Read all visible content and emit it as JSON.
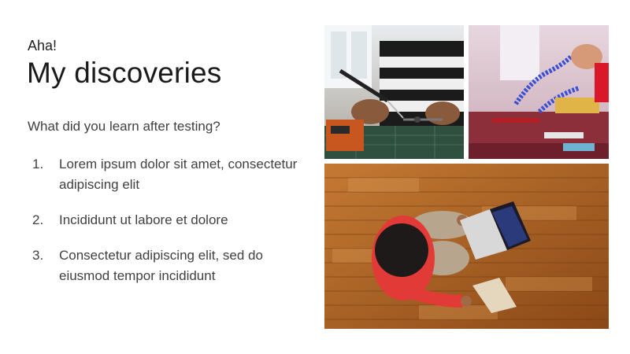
{
  "slide": {
    "eyebrow": "Aha!",
    "title": "My discoveries",
    "prompt": "What did you learn after testing?",
    "items": [
      {
        "number": "1.",
        "text": "Lorem ipsum dolor sit amet, consectetur adipiscing elit"
      },
      {
        "number": "2.",
        "text": "Incididunt ut labore et dolore"
      },
      {
        "number": "3.",
        "text": "Consectetur adipiscing elit, sed do eiusmod tempor incididunt"
      }
    ]
  },
  "photos": {
    "soldering_alt": "Person soldering at a workbench",
    "helping_hands_alt": "Hands adjusting a helping-hands tool on a table",
    "laptop_alt": "Child sitting on a wooden floor with a laptop"
  },
  "colors": {
    "background": "#ffffff",
    "title_text": "#1a1a1a",
    "body_text": "#404040"
  }
}
